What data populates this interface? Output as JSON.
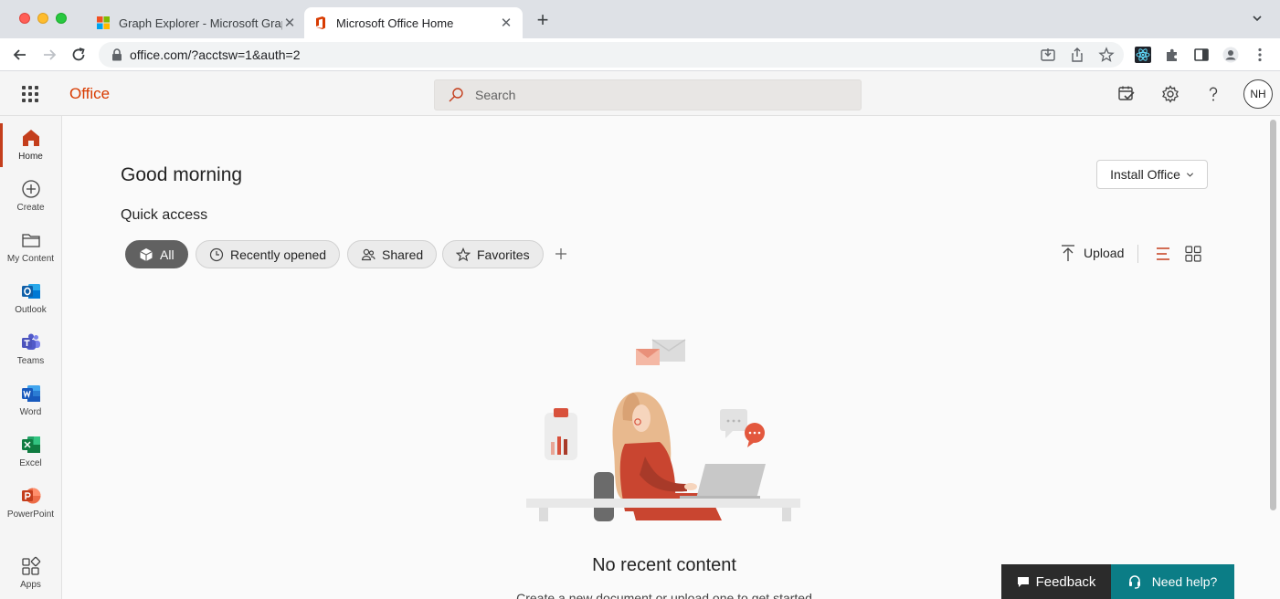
{
  "browser": {
    "tabs": [
      {
        "title": "Graph Explorer - Microsoft Graph",
        "favicon": "microsoft-logo-icon",
        "active": false
      },
      {
        "title": "Microsoft Office Home",
        "favicon": "office-logo-icon",
        "active": true
      }
    ],
    "new_tab_glyph": "+",
    "tab_close_glyph": "✕",
    "url": "office.com/?acctsw=1&auth=2"
  },
  "header": {
    "brand": "Office",
    "search_placeholder": "Search",
    "avatar_initials": "NH"
  },
  "rail": {
    "items": [
      {
        "label": "Home",
        "icon": "home-icon",
        "active": true
      },
      {
        "label": "Create",
        "icon": "plus-circle-icon"
      },
      {
        "label": "My Content",
        "icon": "folder-icon"
      },
      {
        "label": "Outlook",
        "icon": "outlook-icon"
      },
      {
        "label": "Teams",
        "icon": "teams-icon"
      },
      {
        "label": "Word",
        "icon": "word-icon"
      },
      {
        "label": "Excel",
        "icon": "excel-icon"
      },
      {
        "label": "PowerPoint",
        "icon": "powerpoint-icon"
      },
      {
        "label": "Apps",
        "icon": "apps-icon"
      }
    ]
  },
  "main": {
    "greeting": "Good morning",
    "install_label": "Install Office",
    "quick_access_title": "Quick access",
    "filters": [
      {
        "label": "All",
        "icon": "cube-icon",
        "active": true
      },
      {
        "label": "Recently opened",
        "icon": "clock-icon"
      },
      {
        "label": "Shared",
        "icon": "people-icon"
      },
      {
        "label": "Favorites",
        "icon": "star-icon"
      }
    ],
    "upload_label": "Upload",
    "empty_title": "No recent content",
    "empty_subtitle": "Create a new document or upload one to get started"
  },
  "footer": {
    "feedback_label": "Feedback",
    "help_label": "Need help?"
  },
  "colors": {
    "office_accent": "#d83b01",
    "rail_active": "#c43e1c",
    "help_teal": "#0b7d86"
  }
}
